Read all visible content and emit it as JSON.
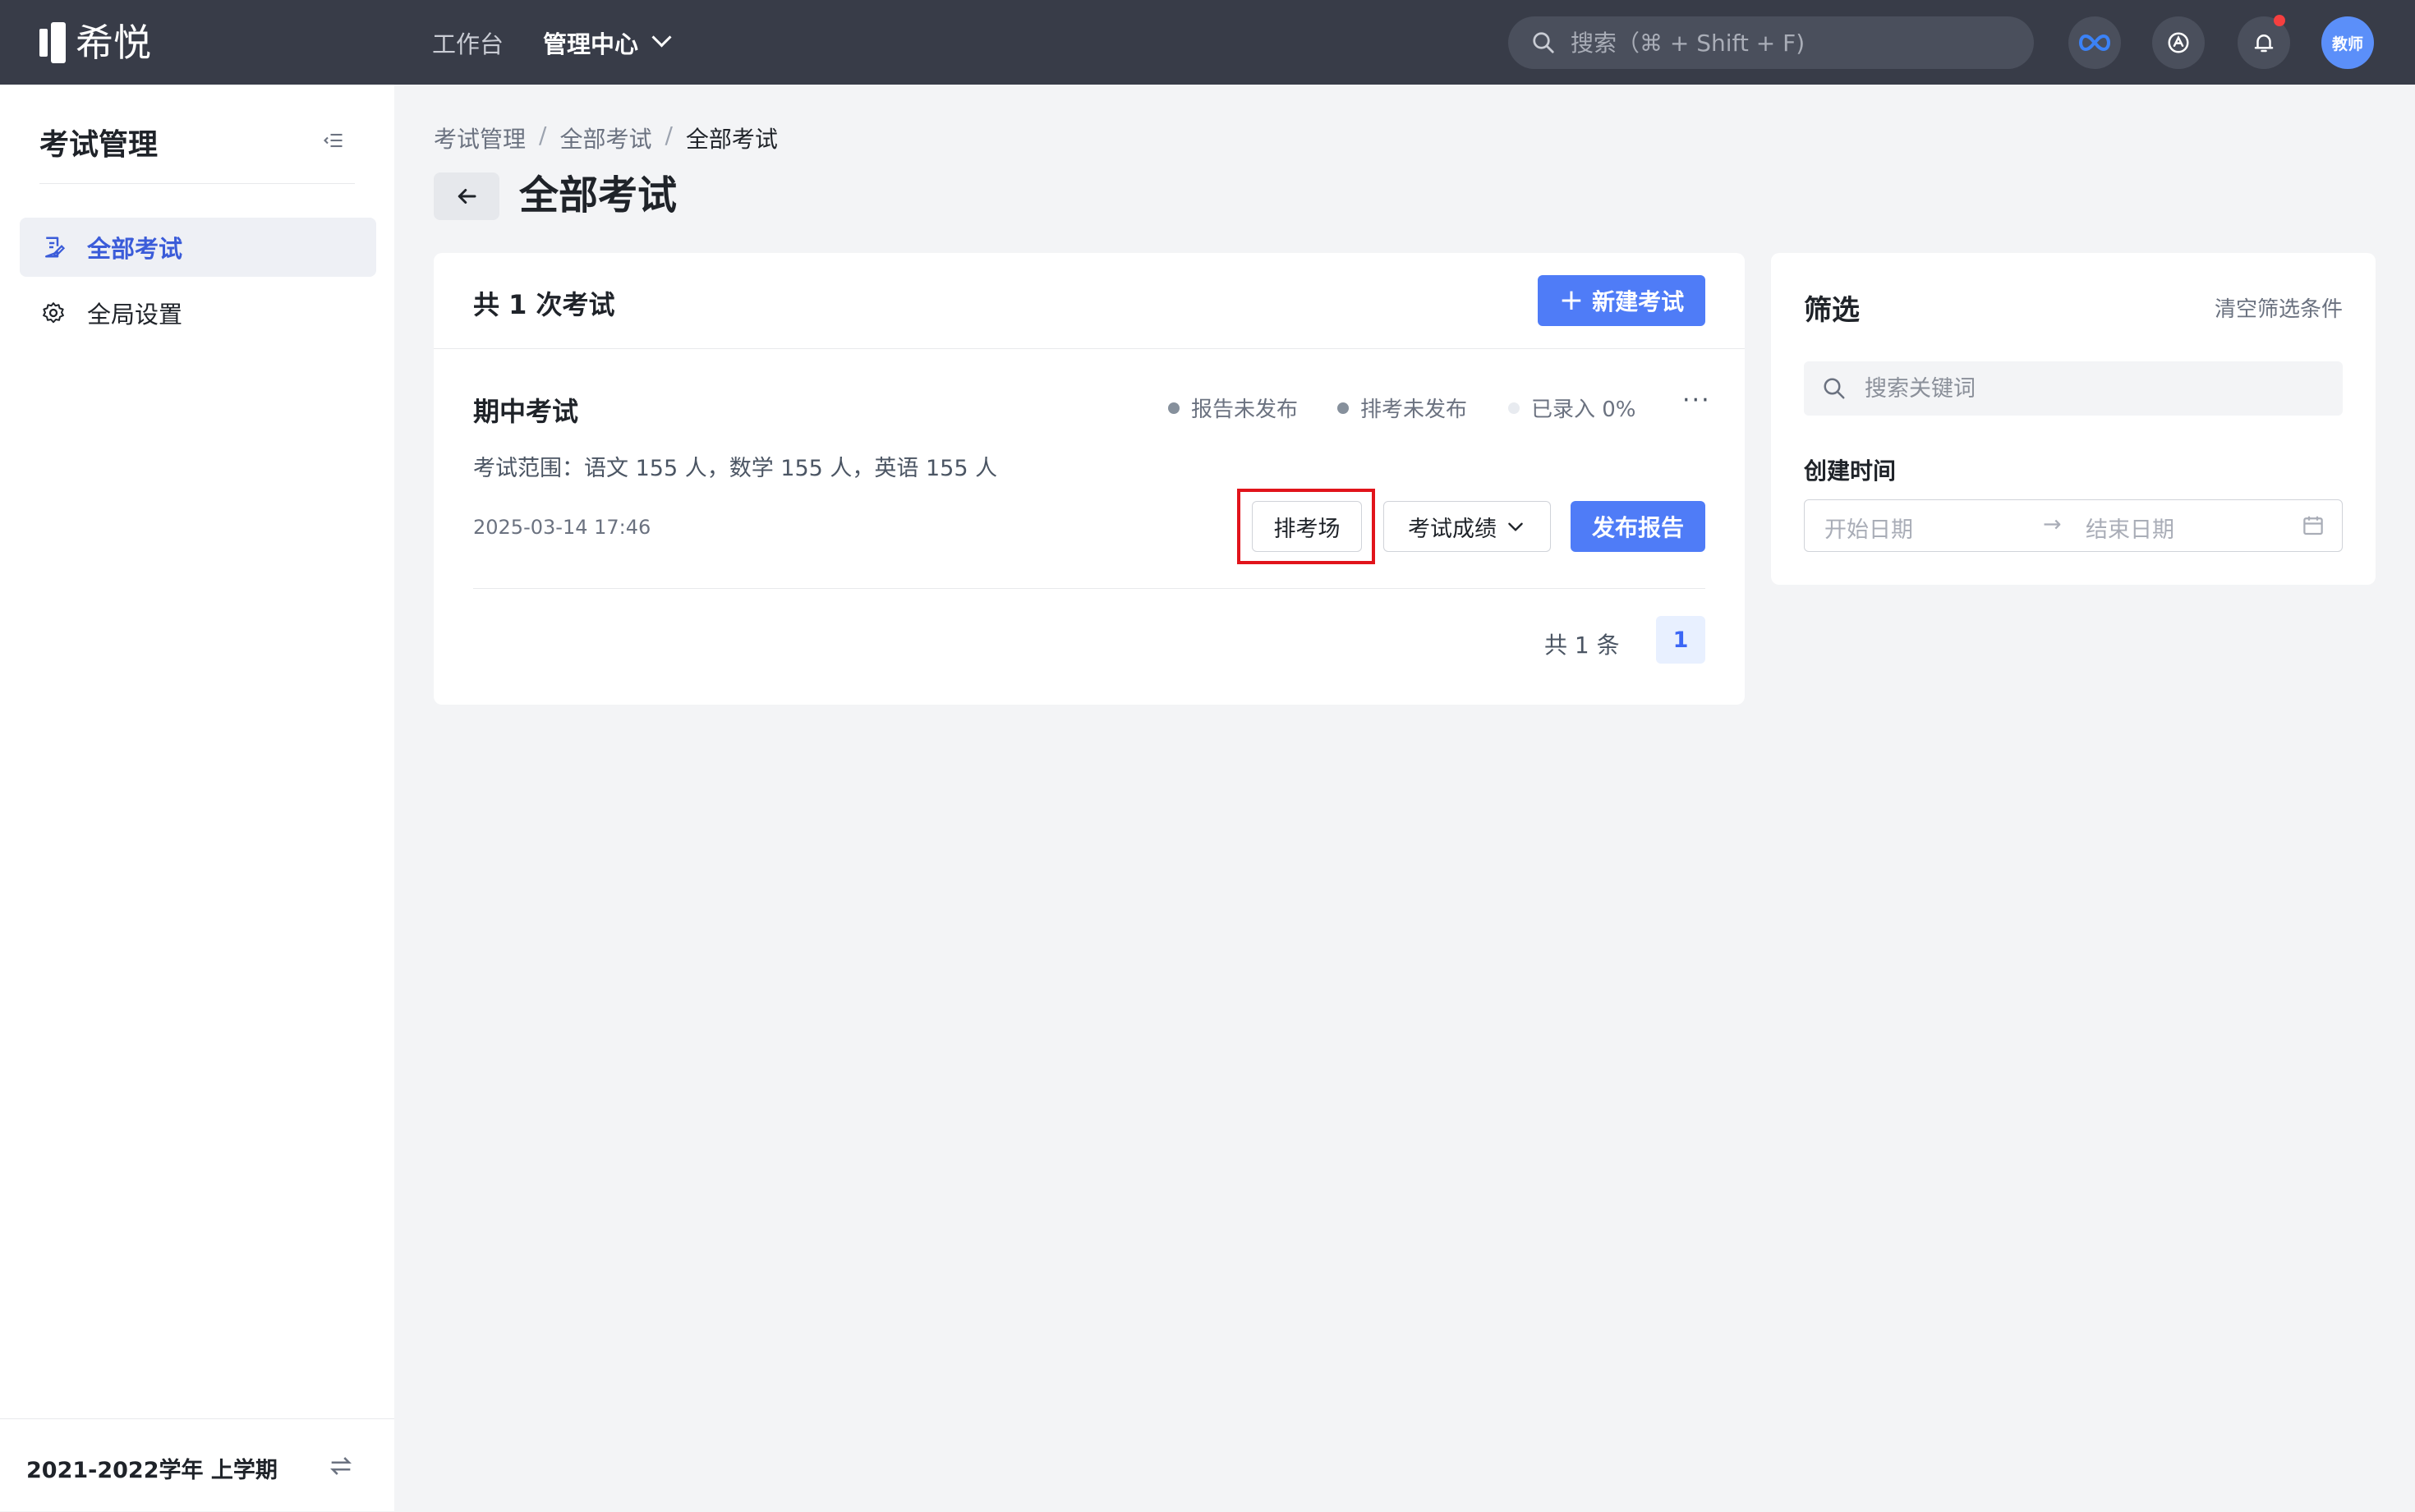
{
  "brand": {
    "name": "希悦"
  },
  "topnav": {
    "workbench": "工作台",
    "admin_center": "管理中心"
  },
  "search": {
    "placeholder": "搜索（⌘ + Shift + F)"
  },
  "user": {
    "avatar_text": "教师"
  },
  "sidebar": {
    "title": "考试管理",
    "items": [
      {
        "label": "全部考试",
        "icon": "edit-doc-icon",
        "active": true
      },
      {
        "label": "全局设置",
        "icon": "gear-icon",
        "active": false
      }
    ],
    "term": "2021-2022学年 上学期"
  },
  "breadcrumb": [
    "考试管理",
    "全部考试",
    "全部考试"
  ],
  "page": {
    "title": "全部考试"
  },
  "exam_list": {
    "count_text": "共 1 次考试",
    "new_button": "新建考试",
    "exam": {
      "name": "期中考试",
      "status_report": "报告未发布",
      "status_arrange": "排考未发布",
      "status_entry": "已录入 0%",
      "scope": "考试范围：语文 155 人，数学 155 人，英语 155 人",
      "created": "2025-03-14 17:46",
      "arrange_button": "排考场",
      "scores_button": "考试成绩",
      "publish_button": "发布报告"
    },
    "pagination": {
      "total_text": "共 1 条",
      "current_page": "1"
    }
  },
  "filter": {
    "title": "筛选",
    "clear": "清空筛选条件",
    "keyword_placeholder": "搜索关键词",
    "created_time_label": "创建时间",
    "start_placeholder": "开始日期",
    "end_placeholder": "结束日期"
  },
  "colors": {
    "topbar": "#383c48",
    "primary": "#4f7cf7",
    "highlight": "#e1141b",
    "active_text": "#3b5cd9"
  }
}
